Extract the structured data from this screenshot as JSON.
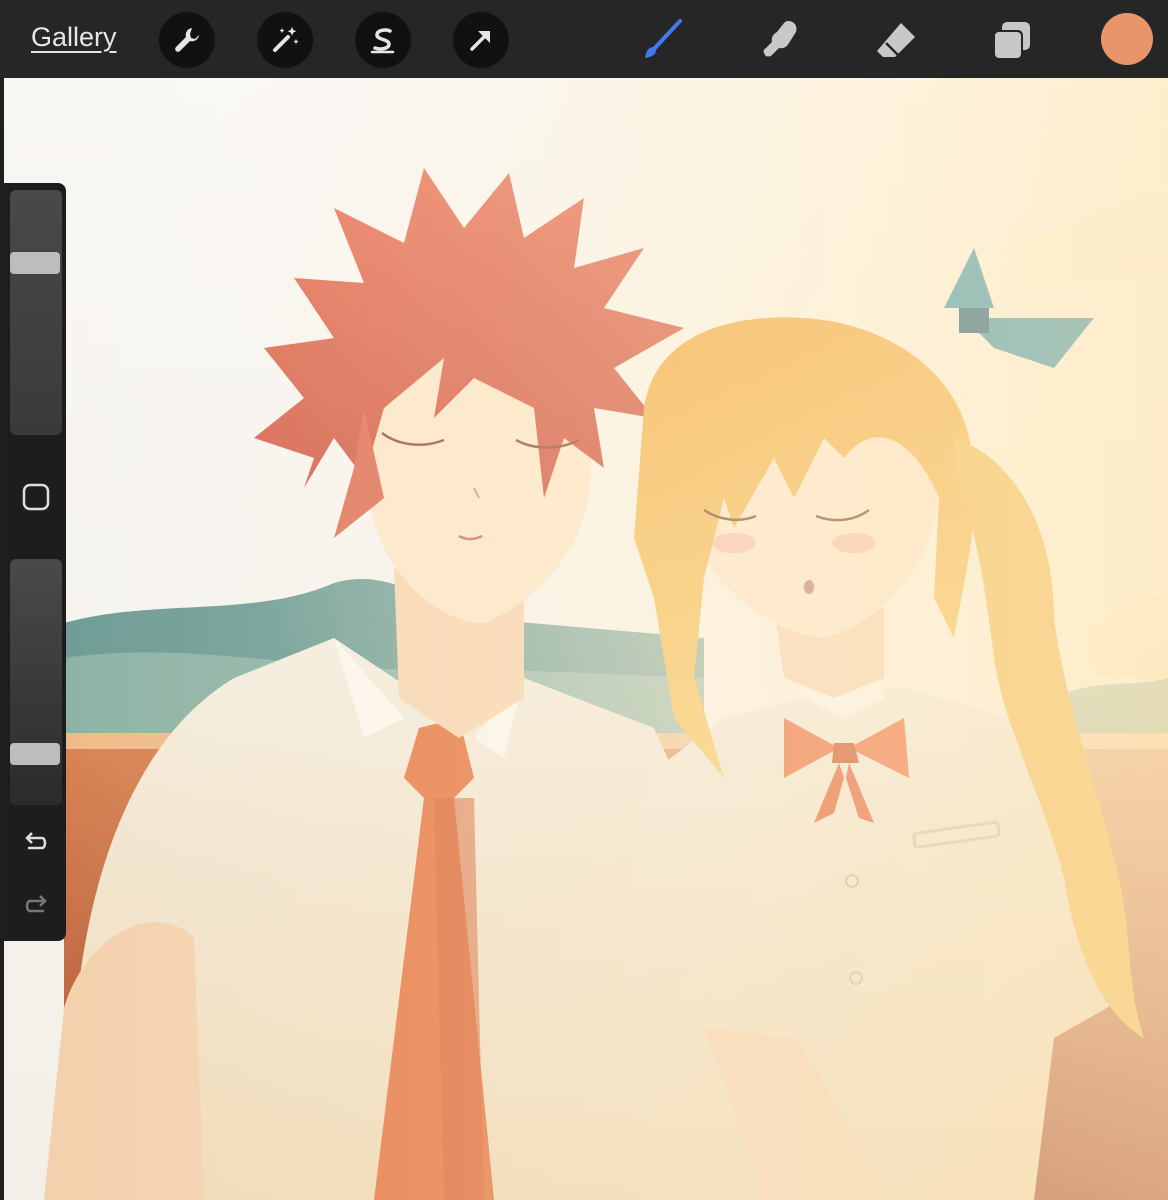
{
  "toolbar": {
    "gallery_label": "Gallery",
    "left_tools": [
      {
        "name": "actions",
        "icon": "wrench-icon"
      },
      {
        "name": "adjustments",
        "icon": "magic-wand-icon"
      },
      {
        "name": "selection",
        "icon": "selection-s-icon"
      },
      {
        "name": "transform",
        "icon": "arrow-cursor-icon"
      }
    ],
    "right_tools": [
      {
        "name": "brush",
        "icon": "brush-icon",
        "active": true
      },
      {
        "name": "smudge",
        "icon": "smudge-finger-icon"
      },
      {
        "name": "eraser",
        "icon": "eraser-icon"
      },
      {
        "name": "layers",
        "icon": "layers-icon"
      }
    ],
    "current_color": "#E8956A",
    "active_tool_color": "#3F7BEF"
  },
  "sidebar": {
    "brush_size_level": 0.72,
    "opacity_level": 0.18,
    "buttons": [
      "modify-square-icon",
      "undo-icon",
      "redo-icon"
    ]
  }
}
